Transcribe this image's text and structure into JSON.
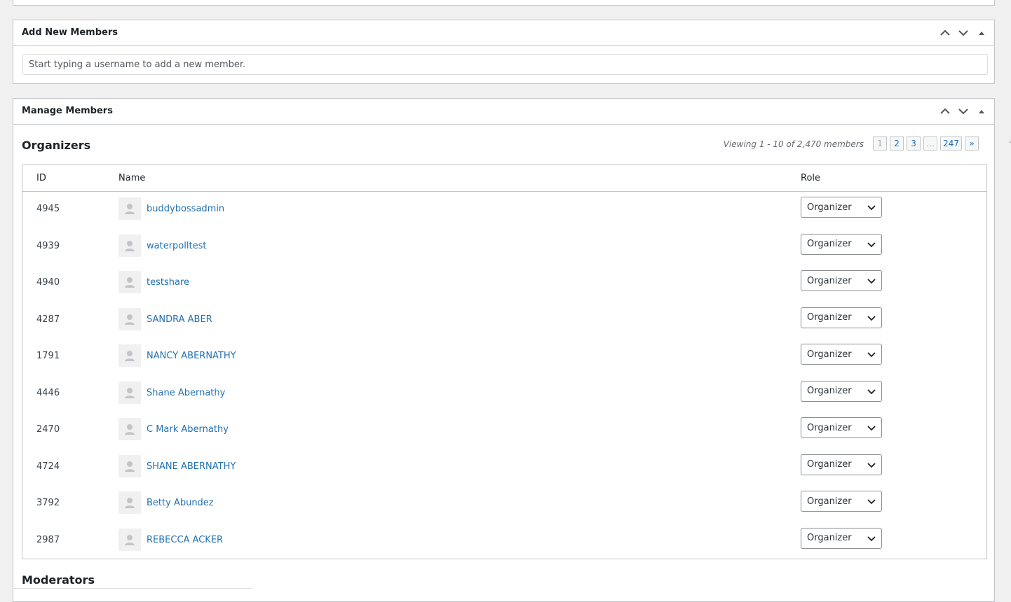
{
  "add_panel": {
    "title": "Add New Members",
    "input_placeholder": "Start typing a username to add a new member."
  },
  "manage_panel": {
    "title": "Manage Members",
    "organizers_title": "Organizers",
    "viewing_text": "Viewing 1 - 10 of 2,470 members",
    "pagination": [
      "1",
      "2",
      "3",
      "…",
      "247",
      "»"
    ],
    "columns": {
      "id": "ID",
      "name": "Name",
      "role": "Role"
    },
    "members": [
      {
        "id": "4945",
        "name": "buddybossadmin",
        "role": "Organizer"
      },
      {
        "id": "4939",
        "name": "waterpolltest",
        "role": "Organizer"
      },
      {
        "id": "4940",
        "name": "testshare",
        "role": "Organizer"
      },
      {
        "id": "4287",
        "name": "SANDRA ABER",
        "role": "Organizer"
      },
      {
        "id": "1791",
        "name": "NANCY ABERNATHY",
        "role": "Organizer"
      },
      {
        "id": "4446",
        "name": "Shane Abernathy",
        "role": "Organizer"
      },
      {
        "id": "2470",
        "name": "C Mark Abernathy",
        "role": "Organizer"
      },
      {
        "id": "4724",
        "name": "SHANE ABERNATHY",
        "role": "Organizer"
      },
      {
        "id": "3792",
        "name": "Betty Abundez",
        "role": "Organizer"
      },
      {
        "id": "2987",
        "name": "REBECCA ACKER",
        "role": "Organizer"
      }
    ],
    "moderators_title": "Moderators"
  },
  "icons": {
    "move_up": "chevron-up-icon",
    "move_down": "chevron-down-icon",
    "toggle": "triangle-up-icon",
    "avatar": "user-silhouette-icon",
    "select": "chevron-down-icon"
  }
}
